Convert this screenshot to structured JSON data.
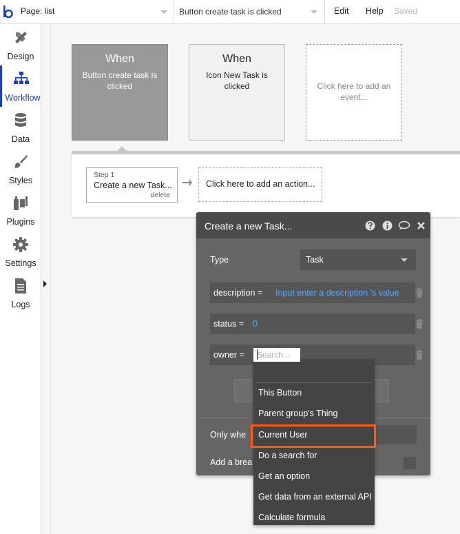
{
  "topbar": {
    "page_label": "Page: list",
    "event_label": "Button create task is clicked",
    "edit": "Edit",
    "help": "Help",
    "status": "Saved"
  },
  "sidebar": {
    "items": [
      {
        "label": "Design",
        "icon": "design-icon"
      },
      {
        "label": "Workflow",
        "icon": "workflow-icon",
        "active": true
      },
      {
        "label": "Data",
        "icon": "database-icon"
      },
      {
        "label": "Styles",
        "icon": "brush-icon"
      },
      {
        "label": "Plugins",
        "icon": "plugin-icon"
      },
      {
        "label": "Settings",
        "icon": "gear-icon"
      },
      {
        "label": "Logs",
        "icon": "document-icon"
      }
    ]
  },
  "events": [
    {
      "when": "When",
      "desc": "Button create task is clicked",
      "selected": true
    },
    {
      "when": "When",
      "desc": "Icon New Task is clicked"
    },
    {
      "desc": "Click here to add an event..."
    }
  ],
  "actions": {
    "step_num": "Step 1",
    "step_title": "Create a new Task...",
    "delete": "delete",
    "add": "Click here to add an action..."
  },
  "panel": {
    "title": "Create a new Task...",
    "type_label": "Type",
    "type_value": "Task",
    "fields": [
      {
        "key": "description =",
        "value": "Input enter a description 's value"
      },
      {
        "key": "status =",
        "value": "0"
      },
      {
        "key": "owner =",
        "placeholder": "Search..."
      }
    ],
    "only_when": "Only whe",
    "breakpoint": "Add a brea"
  },
  "dropdown": {
    "items": [
      "This Button",
      "Parent group's Thing",
      "Current User",
      "Do a search for",
      "Get an option",
      "Get data from an external API",
      "Calculate formula"
    ],
    "highlighted": "Current User",
    "highlight_color": "#ff5a14"
  },
  "colors": {
    "accent": "#1a3fc2",
    "dynamic_text": "#5aa9ff",
    "panel_bg": "#656565"
  }
}
